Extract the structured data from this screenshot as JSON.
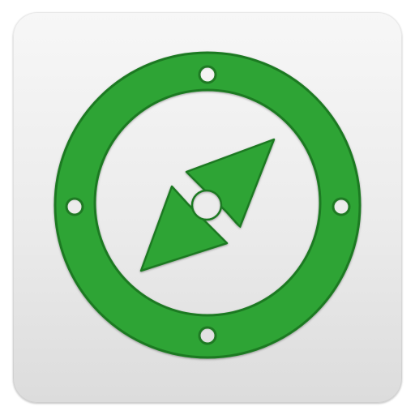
{
  "app_icon": {
    "icon": "compass-icon",
    "colors": {
      "ring_green": "#2fa435",
      "ring_edge": "#1f7a24",
      "hole_fill": "#ffffff",
      "tile_top": "#f7f7f7",
      "tile_bottom": "#dcdcdc"
    }
  }
}
